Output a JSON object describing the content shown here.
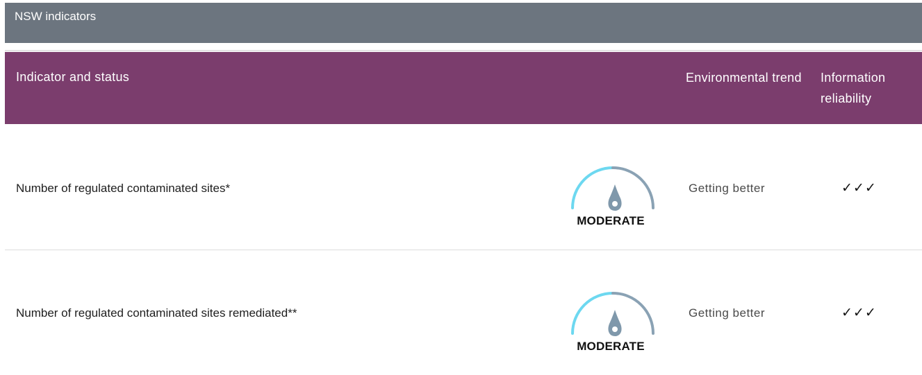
{
  "table": {
    "caption": "NSW indicators",
    "headers": {
      "indicator": "Indicator and status",
      "trend": "Environmental trend",
      "reliability": "Information reliability"
    },
    "rows": [
      {
        "indicator": "Number of regulated contaminated sites*",
        "status": "MODERATE",
        "trend": "Getting better",
        "reliability": "✓✓✓"
      },
      {
        "indicator": "Number of regulated contaminated sites remediated**",
        "status": "MODERATE",
        "trend": "Getting better",
        "reliability": "✓✓✓"
      }
    ]
  },
  "colors": {
    "caption_bg": "#6c757f",
    "header_bg": "#7b3d6d",
    "gauge_good": "#6dd8f0",
    "gauge_rest": "#8aa2b4",
    "needle": "#7f98ab"
  }
}
